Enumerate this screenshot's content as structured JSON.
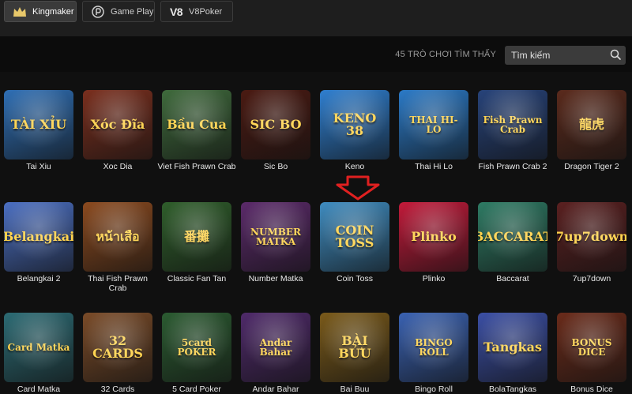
{
  "providers": [
    {
      "label": "Kingmaker",
      "icon": "kingmaker-logo-icon"
    },
    {
      "label": "Game Play",
      "icon": "gameplay-logo-icon"
    },
    {
      "label": "V8Poker",
      "icon": "v8poker-logo-icon",
      "logo_text": "V8"
    }
  ],
  "filter": {
    "count_text": "45 TRÒ CHƠI TÌM THẤY",
    "search_placeholder": "Tìm kiếm"
  },
  "games": [
    {
      "name": "Tai Xiu",
      "art": "TÀI XỈU",
      "bg": "#2f6fb5"
    },
    {
      "name": "Xoc Dia",
      "art": "Xóc Đĩa",
      "bg": "#7a2f1e"
    },
    {
      "name": "Viet Fish Prawn Crab",
      "art": "Bầu Cua",
      "bg": "#3f6a3c"
    },
    {
      "name": "Sic Bo",
      "art": "SIC BO",
      "bg": "#4a1a12"
    },
    {
      "name": "Keno",
      "art": "KENO 38",
      "bg": "#2f7fd0"
    },
    {
      "name": "Thai Hi Lo",
      "art": "THAI HI-LO",
      "bg": "#2b7ac7"
    },
    {
      "name": "Fish Prawn Crab 2",
      "art": "Fish Prawn Crab",
      "bg": "#27437a"
    },
    {
      "name": "Dragon Tiger 2",
      "art": "龍虎",
      "bg": "#5a2a1c"
    },
    {
      "name": "Belangkai 2",
      "art": "Belangkai",
      "bg": "#4b6fc2"
    },
    {
      "name": "Thai Fish Prawn Crab",
      "art": "หน้าเสือ",
      "bg": "#8b4a1f"
    },
    {
      "name": "Classic Fan Tan",
      "art": "番攤",
      "bg": "#2f5e2b"
    },
    {
      "name": "Number Matka",
      "art": "NUMBER MATKA",
      "bg": "#5b2a6a"
    },
    {
      "name": "Coin Toss",
      "art": "COIN TOSS",
      "bg": "#3f8cc0"
    },
    {
      "name": "Plinko",
      "art": "Plinko",
      "bg": "#c21a3a"
    },
    {
      "name": "Baccarat",
      "art": "BACCARAT",
      "bg": "#2e7b64"
    },
    {
      "name": "7up7down",
      "art": "7up7down",
      "bg": "#5a2020"
    },
    {
      "name": "Card Matka",
      "art": "Card Matka",
      "bg": "#2c6b74"
    },
    {
      "name": "32 Cards",
      "art": "32 CARDS",
      "bg": "#7a4b28"
    },
    {
      "name": "5 Card Poker",
      "art": "5card POKER",
      "bg": "#2b5b31"
    },
    {
      "name": "Andar Bahar",
      "art": "Andar Bahar",
      "bg": "#4f2a6a"
    },
    {
      "name": "Bai Buu",
      "art": "BÀI BỬU",
      "bg": "#7a5a1a"
    },
    {
      "name": "Bingo Roll",
      "art": "BINGO ROLL",
      "bg": "#3a62b2"
    },
    {
      "name": "BolaTangkas",
      "art": "Tangkas",
      "bg": "#3b4fa5"
    },
    {
      "name": "Bonus Dice",
      "art": "BONUS DICE",
      "bg": "#6a2b1a"
    }
  ],
  "colors": {
    "background": "#101010",
    "topbar": "#1e1e1e",
    "arrow": "#e02020",
    "art_text": "#ffd24a"
  }
}
